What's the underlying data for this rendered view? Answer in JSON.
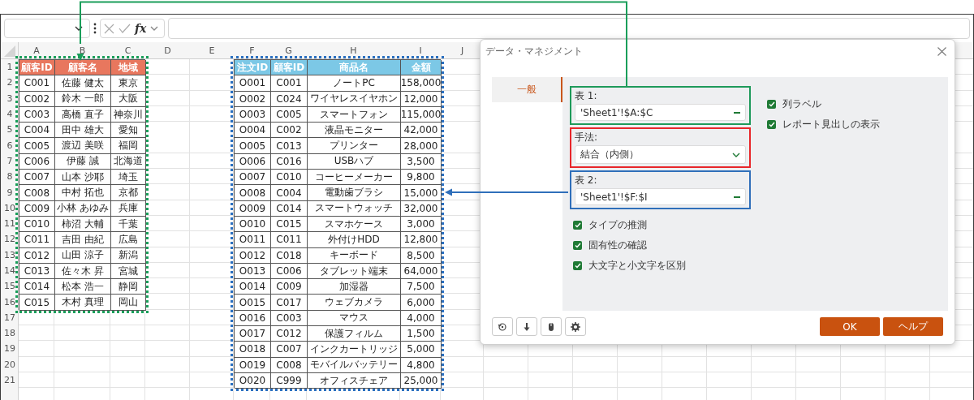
{
  "formula_bar": {
    "function_label": "fx"
  },
  "sheet": {
    "columns": [
      "A",
      "B",
      "C",
      "D",
      "E",
      "F",
      "G",
      "H",
      "I",
      "J"
    ],
    "row_numbers": [
      "1",
      "2",
      "3",
      "4",
      "5",
      "6",
      "7",
      "8",
      "9",
      "10",
      "11",
      "12",
      "13",
      "14",
      "15",
      "16",
      "17",
      "18",
      "19",
      "20",
      "21"
    ],
    "tables": [
      {
        "color": "#e8775e",
        "selection": {
          "color": "#1a9e5a"
        },
        "headers": [
          "顧客ID",
          "顧客名",
          "地域"
        ],
        "rows": [
          [
            "C001",
            "佐藤 健太",
            "東京"
          ],
          [
            "C002",
            "鈴木 一郎",
            "大阪"
          ],
          [
            "C003",
            "高橋 直子",
            "神奈川"
          ],
          [
            "C004",
            "田中 雄大",
            "愛知"
          ],
          [
            "C005",
            "渡辺 美咲",
            "福岡"
          ],
          [
            "C006",
            "伊藤 誠",
            "北海道"
          ],
          [
            "C007",
            "山本 沙耶",
            "埼玉"
          ],
          [
            "C008",
            "中村 拓也",
            "京都"
          ],
          [
            "C009",
            "小林 あゆみ",
            "兵庫"
          ],
          [
            "C010",
            "柿沼 大輔",
            "千葉"
          ],
          [
            "C011",
            "吉田 由紀",
            "広島"
          ],
          [
            "C012",
            "山田 涼子",
            "新潟"
          ],
          [
            "C013",
            "佐々木 昇",
            "宮城"
          ],
          [
            "C014",
            "松本 浩一",
            "静岡"
          ],
          [
            "C015",
            "木村 真理",
            "岡山"
          ]
        ]
      },
      {
        "color": "#7cc8e6",
        "selection": {
          "color": "#2a6fc0"
        },
        "headers": [
          "注文ID",
          "顧客ID",
          "商品名",
          "金額"
        ],
        "rows": [
          [
            "O001",
            "C001",
            "ノートPC",
            "158,000"
          ],
          [
            "O002",
            "C024",
            "ワイヤレスイヤホン",
            "12,000"
          ],
          [
            "O003",
            "C005",
            "スマートフォン",
            "115,000"
          ],
          [
            "O004",
            "C002",
            "液晶モニター",
            "42,000"
          ],
          [
            "O005",
            "C013",
            "プリンター",
            "28,000"
          ],
          [
            "O006",
            "C016",
            "USBハブ",
            "3,500"
          ],
          [
            "O007",
            "C010",
            "コーヒーメーカー",
            "9,800"
          ],
          [
            "O008",
            "C004",
            "電動歯ブラシ",
            "15,000"
          ],
          [
            "O009",
            "C014",
            "スマートウォッチ",
            "32,000"
          ],
          [
            "O010",
            "C015",
            "スマホケース",
            "3,000"
          ],
          [
            "O011",
            "C011",
            "外付けHDD",
            "12,800"
          ],
          [
            "O012",
            "C018",
            "キーボード",
            "8,500"
          ],
          [
            "O013",
            "C006",
            "タブレット端末",
            "64,000"
          ],
          [
            "O014",
            "C009",
            "加湿器",
            "7,500"
          ],
          [
            "O015",
            "C017",
            "ウェブカメラ",
            "6,000"
          ],
          [
            "O016",
            "C003",
            "マウス",
            "4,000"
          ],
          [
            "O017",
            "C012",
            "保護フィルム",
            "1,500"
          ],
          [
            "O018",
            "C007",
            "インクカートリッジ",
            "5,000"
          ],
          [
            "O019",
            "C008",
            "モバイルバッテリー",
            "4,800"
          ],
          [
            "O020",
            "C999",
            "オフィスチェア",
            "25,000"
          ]
        ]
      }
    ]
  },
  "dialog": {
    "title": "データ・マネジメント",
    "tabs": [
      {
        "label": "一般",
        "selected": true
      }
    ],
    "fields": [
      {
        "kind": "range",
        "label": "表 1:",
        "value": "'Sheet1'!$A:$C",
        "color": "#1e9a5a"
      },
      {
        "kind": "dropdown",
        "label": "手法:",
        "value": "結合（内側）",
        "color": "#e8262a"
      },
      {
        "kind": "range",
        "label": "表 2:",
        "value": "'Sheet1'!$F:$I",
        "color": "#2f6fba"
      }
    ],
    "options_left": [
      {
        "label": "タイプの推測",
        "checked": true
      },
      {
        "label": "固有性の確認",
        "checked": true
      },
      {
        "label": "大文字と小文字を区別",
        "checked": true
      }
    ],
    "options_right": [
      {
        "label": "列ラベル",
        "checked": true
      },
      {
        "label": "レポート見出しの表示",
        "checked": true
      }
    ],
    "buttons": [
      "OK",
      "ヘルプ"
    ]
  }
}
